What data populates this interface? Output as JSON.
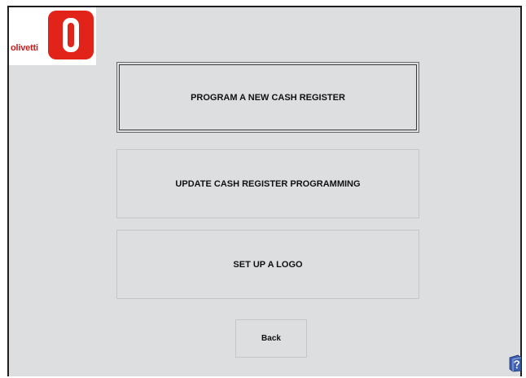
{
  "logo": {
    "brand_text": "olivetti"
  },
  "menu": {
    "program_new_label": "PROGRAM A NEW CASH REGISTER",
    "update_programming_label": "UPDATE CASH REGISTER PROGRAMMING",
    "set_up_logo_label": "SET UP A LOGO"
  },
  "footer": {
    "back_label": "Back",
    "help_icon": "help-book-icon"
  },
  "colors": {
    "background": "#dcdee0",
    "brand_red": "#e2231a",
    "button_border": "#c4c6c9",
    "text": "#111111"
  }
}
